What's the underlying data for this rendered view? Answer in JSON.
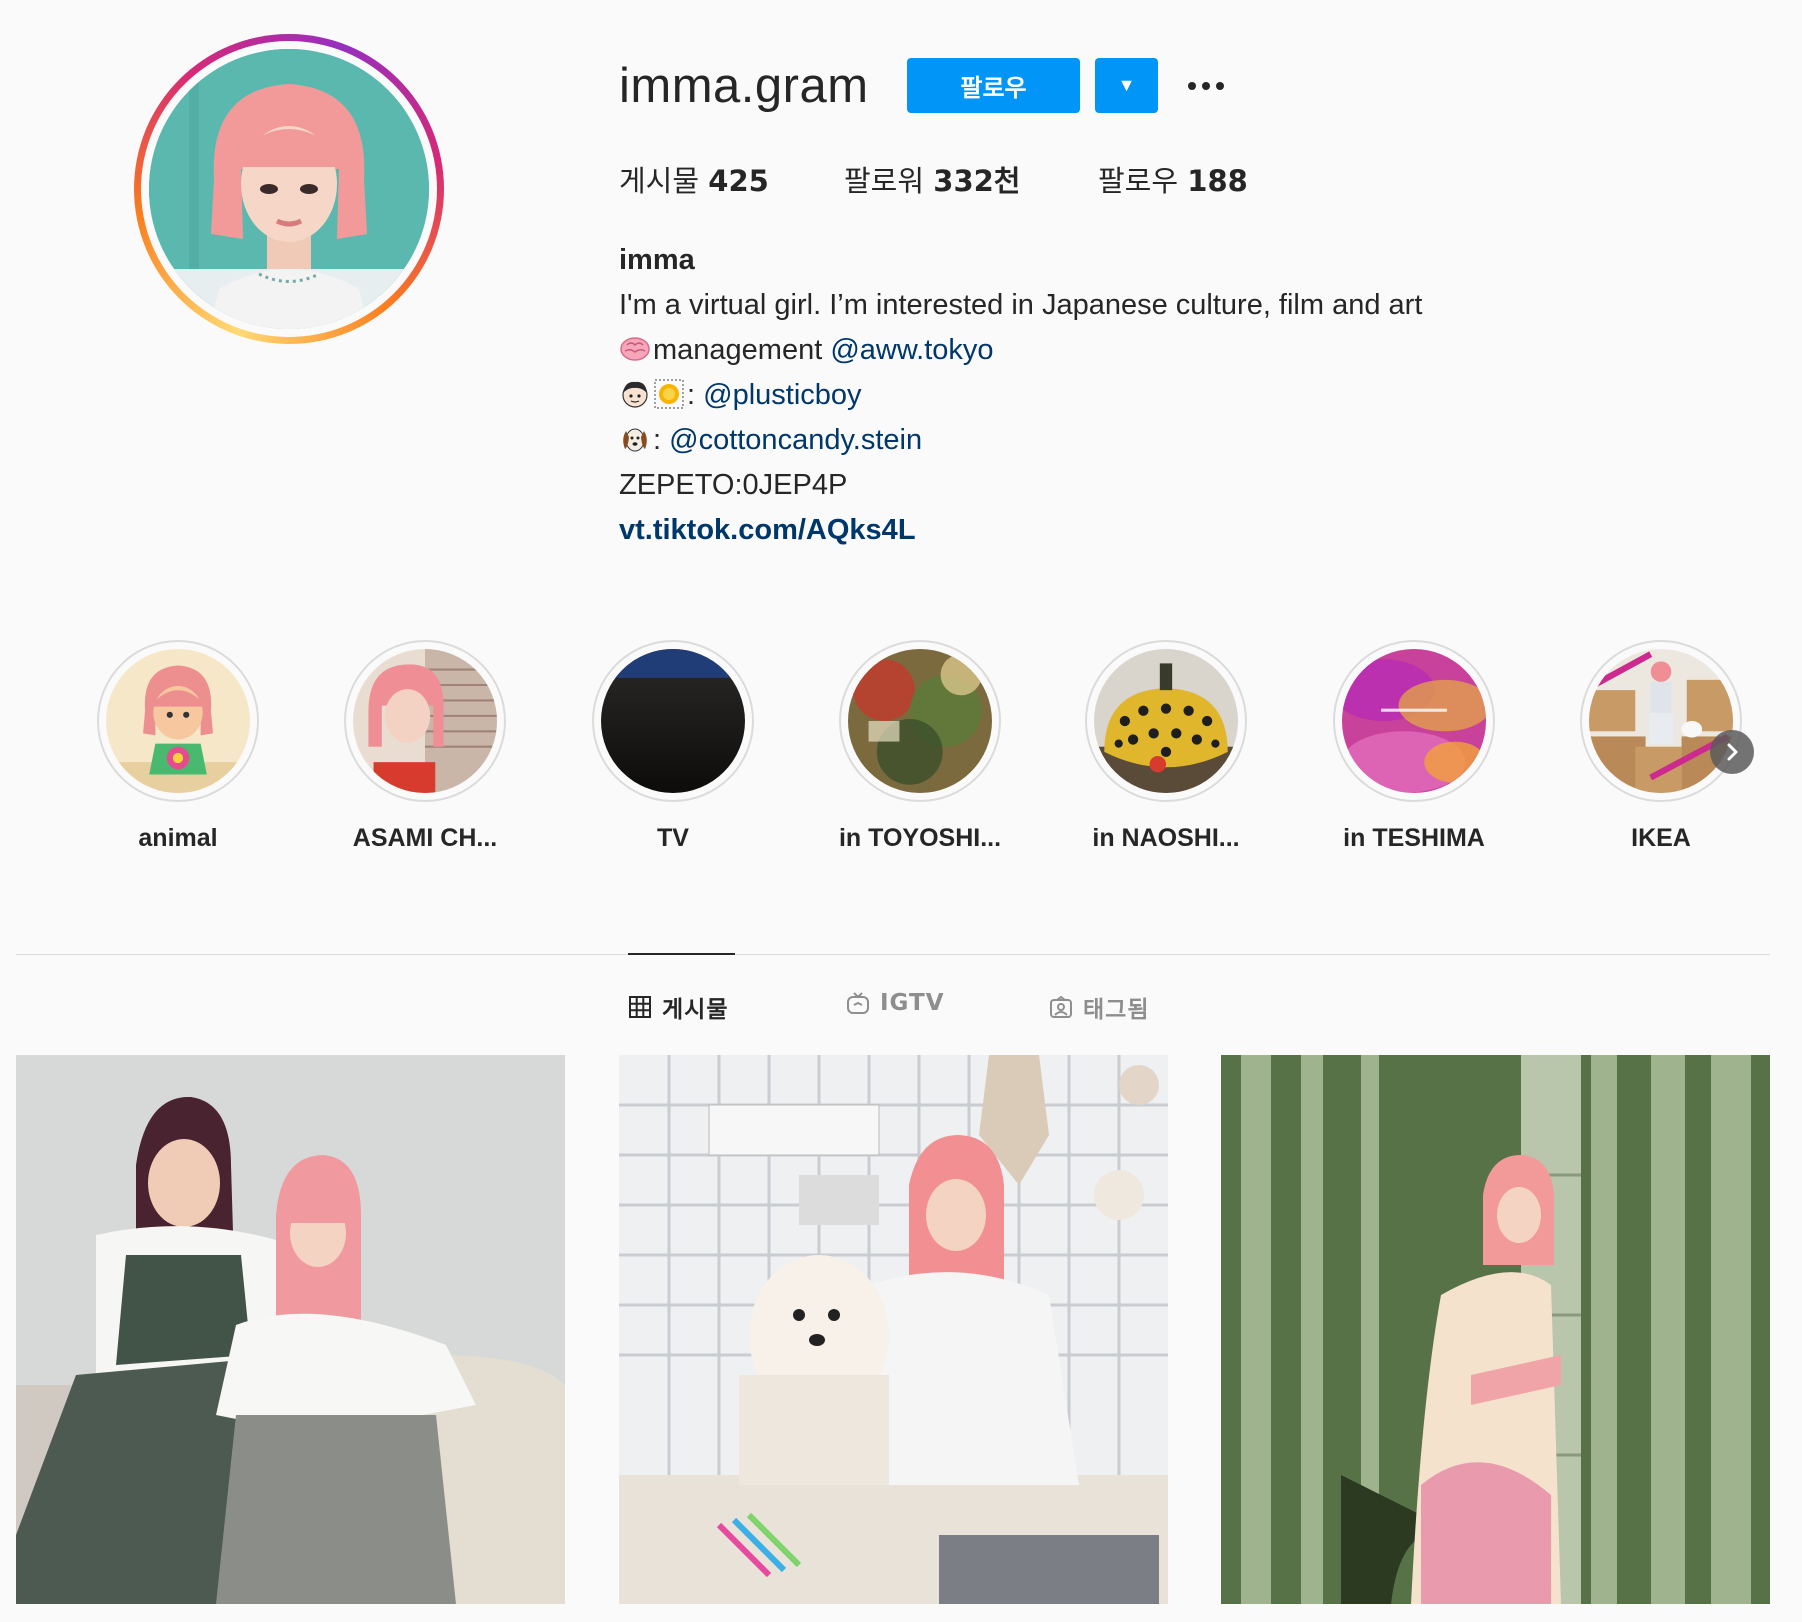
{
  "profile": {
    "username": "imma.gram",
    "follow_label": "팔로우",
    "dropdown_icon": "▼",
    "stats": {
      "posts_label": "게시물",
      "posts_value": "425",
      "followers_label": "팔로워",
      "followers_value": "332천",
      "following_label": "팔로우",
      "following_value": "188"
    },
    "bio": {
      "full_name": "imma",
      "line1": "I'm a virtual girl. I’m interested in Japanese culture, film and art",
      "line2_text": "management ",
      "line2_link": "@aww.tokyo",
      "line3_sep": ": ",
      "line3_link": "@plusticboy",
      "line4_sep": ": ",
      "line4_link": "@cottoncandy.stein",
      "line5": "ZEPETO:0JEP4P",
      "website": "vt.tiktok.com/AQks4L"
    }
  },
  "highlights": [
    {
      "label": "animal"
    },
    {
      "label": "ASAMI CH..."
    },
    {
      "label": "TV"
    },
    {
      "label": "in TOYOSHI..."
    },
    {
      "label": "in NAOSHI..."
    },
    {
      "label": "in TESHIMA"
    },
    {
      "label": "IKEA"
    }
  ],
  "tabs": {
    "posts": "게시물",
    "igtv": "IGTV",
    "tagged": "태그됨"
  },
  "icons": {
    "emoji_brain": "brain-emoji",
    "emoji_boy": "boy-emoji",
    "emoji_placeholder": "emoji-placeholder",
    "emoji_dog": "dog-emoji",
    "next": "chevron-right-icon"
  },
  "colors": {
    "accent": "#0095f6",
    "link": "#00376b",
    "text": "#262626",
    "muted": "#8e8e8e",
    "background": "#fafafa"
  }
}
